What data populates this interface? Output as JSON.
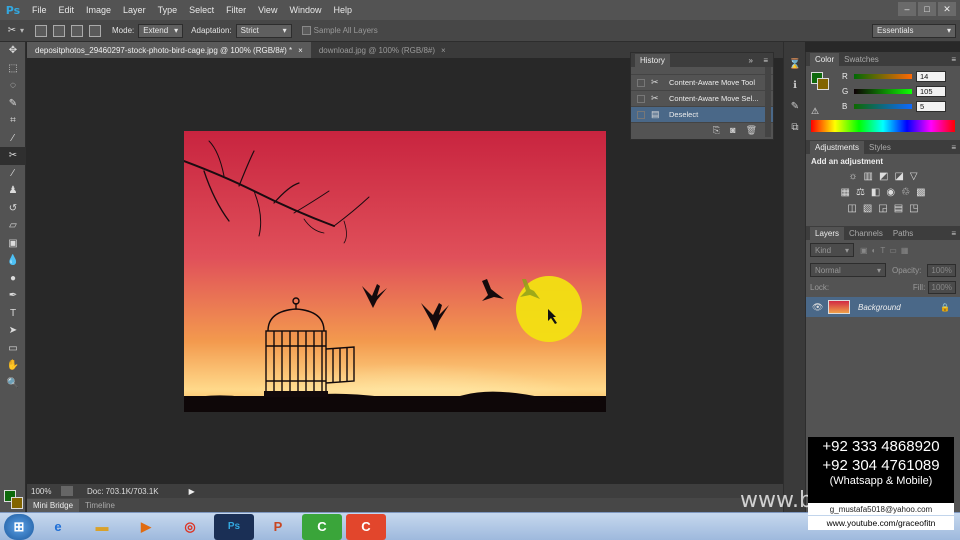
{
  "app": {
    "logo": "Ps"
  },
  "menu": [
    "File",
    "Edit",
    "Image",
    "Layer",
    "Type",
    "Select",
    "Filter",
    "View",
    "Window",
    "Help"
  ],
  "window_controls": [
    "–",
    "□",
    "✕"
  ],
  "options": {
    "mode_label": "Mode:",
    "mode_value": "Extend",
    "adaptation_label": "Adaptation:",
    "adaptation_value": "Strict",
    "sample_all_layers": "Sample All Layers",
    "workspace": "Essentials"
  },
  "tabs": [
    {
      "label": "depositphotos_29460297-stock-photo-bird-cage.jpg @ 100% (RGB/8#) *",
      "close": "×"
    },
    {
      "label": "download.jpg @ 100% (RGB/8#)",
      "close": "×"
    }
  ],
  "history": {
    "title": "History",
    "items": [
      {
        "label": "Content-Aware Move Tool",
        "icon": "move-icon"
      },
      {
        "label": "Content-Aware Move Sel...",
        "icon": "move-icon"
      },
      {
        "label": "Deselect",
        "icon": "doc-icon"
      }
    ]
  },
  "color_panel": {
    "tabs": [
      "Color",
      "Swatches"
    ],
    "r_label": "R",
    "r": "14",
    "g_label": "G",
    "g": "105",
    "b_label": "B",
    "b": "5"
  },
  "adjustments": {
    "tabs": [
      "Adjustments",
      "Styles"
    ],
    "heading": "Add an adjustment"
  },
  "layers": {
    "tabs": [
      "Layers",
      "Channels",
      "Paths"
    ],
    "kind": "Kind",
    "blend": "Normal",
    "opacity_label": "Opacity:",
    "opacity": "100%",
    "fill_label": "Fill:",
    "fill": "100%",
    "lock_label": "Lock:",
    "layer_name": "Background"
  },
  "status": {
    "zoom": "100%",
    "doc": "Doc: 703.1K/703.1K"
  },
  "bottom_tabs": [
    "Mini Bridge",
    "Timeline"
  ],
  "overlay": {
    "phone1": "+92 333 4868920",
    "phone2": "+92 304 4761089",
    "whatsapp": "(Whatsapp & Mobile)",
    "email": "g_mustafa5018@yahoo.com",
    "youtube": "www.youtube.com/graceofitn",
    "watermark": "www.bluts.com"
  },
  "colors": {
    "accent": "#4a6888",
    "fg": "#0e690c",
    "bg": "#826400"
  }
}
